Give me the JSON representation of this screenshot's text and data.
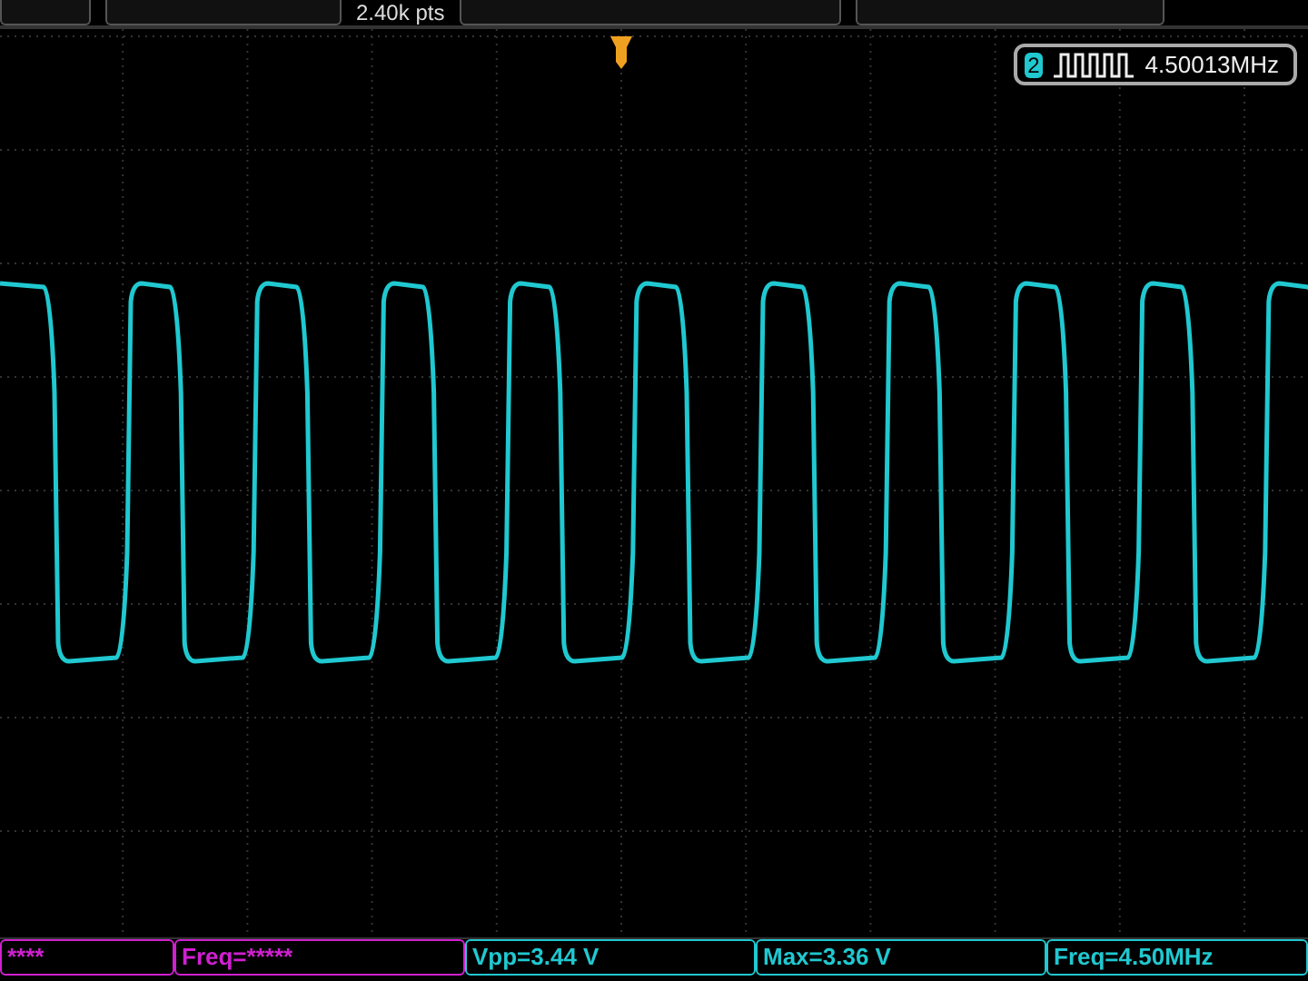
{
  "header": {
    "memory_depth": "2.40k pts"
  },
  "frequency_counter": {
    "channel": "2",
    "reading": "4.50013MHz"
  },
  "measurements": [
    {
      "text": "****",
      "color": "#d020d0"
    },
    {
      "text": "Freq=*****",
      "color": "#d020d0"
    },
    {
      "text": "Vpp=3.44 V",
      "color": "#20c8d0"
    },
    {
      "text": "Max=3.36 V",
      "color": "#20c8d0"
    },
    {
      "text": "Freq=4.50MHz",
      "color": "#20c8d0"
    }
  ]
}
